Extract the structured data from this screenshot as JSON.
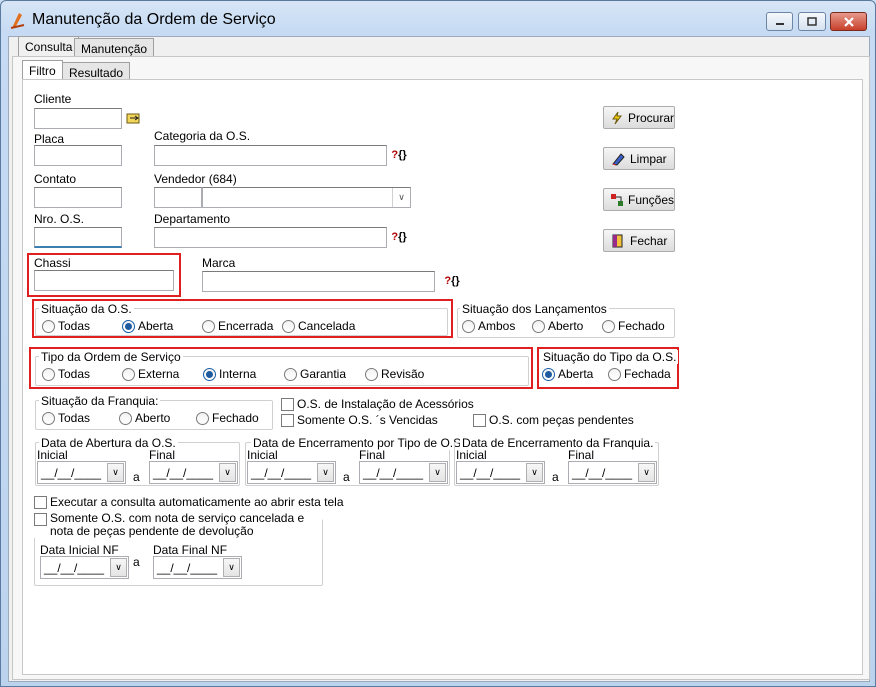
{
  "window": {
    "title": "Manutenção da Ordem de Serviço",
    "minimize_icon": "minimize-icon",
    "maximize_icon": "maximize-icon",
    "close_icon": "close-icon"
  },
  "main_tabs": [
    {
      "label": "Consulta"
    },
    {
      "label": "Manutenção"
    }
  ],
  "sub_tabs": [
    {
      "label": "Filtro"
    },
    {
      "label": "Resultado"
    }
  ],
  "fields": {
    "cliente": {
      "label": "Cliente",
      "value": ""
    },
    "placa": {
      "label": "Placa",
      "value": ""
    },
    "categoria": {
      "label": "Categoria da O.S.",
      "value": ""
    },
    "contato": {
      "label": "Contato",
      "value": ""
    },
    "vendedor": {
      "label": "Vendedor (684)",
      "value": ""
    },
    "nro_os": {
      "label": "Nro. O.S.",
      "value": ""
    },
    "departamento": {
      "label": "Departamento",
      "value": ""
    },
    "chassi": {
      "label": "Chassi",
      "value": ""
    },
    "marca": {
      "label": "Marca",
      "value": ""
    }
  },
  "buttons": {
    "procurar": "Procurar",
    "limpar": "Limpar",
    "funcoes": "Funções",
    "fechar": "Fechar"
  },
  "situacao_os": {
    "title": "Situação da O.S.",
    "options": [
      "Todas",
      "Aberta",
      "Encerrada",
      "Cancelada"
    ],
    "selected": "Aberta"
  },
  "situacao_lancamentos": {
    "title": "Situação dos Lançamentos",
    "options": [
      "Ambos",
      "Aberto",
      "Fechado"
    ],
    "selected": ""
  },
  "tipo_os": {
    "title": "Tipo da Ordem de Serviço",
    "options": [
      "Todas",
      "Externa",
      "Interna",
      "Garantia",
      "Revisão"
    ],
    "selected": "Interna"
  },
  "situacao_tipo_os": {
    "title": "Situação do Tipo da O.S.",
    "options": [
      "Aberta",
      "Fechada"
    ],
    "selected": "Aberta"
  },
  "situacao_franquia": {
    "title": "Situação da Franquia:",
    "options": [
      "Todas",
      "Aberto",
      "Fechado"
    ],
    "selected": ""
  },
  "checks": {
    "instalacao": "O.S. de Instalação de Acessórios",
    "vencidas": "Somente O.S. ´s Vencidas",
    "pecas_pendentes": "O.S. com peças pendentes",
    "executar_auto": "Executar a consulta automaticamente ao abrir esta tela",
    "nota_cancelada": "Somente O.S. com nota de serviço cancelada e nota de peças pendente de devolução"
  },
  "date_groups": [
    {
      "title": "Data de Abertura da O.S.",
      "inicial": "Inicial",
      "final": "Final",
      "sep": "a",
      "ini_value": "__/__/____",
      "fin_value": "__/__/____"
    },
    {
      "title": "Data de Encerramento por Tipo de O.S.",
      "inicial": "Inicial",
      "final": "Final",
      "sep": "a",
      "ini_value": "__/__/____",
      "fin_value": "__/__/____"
    },
    {
      "title": "Data de Encerramento da Franquia.",
      "inicial": "Inicial",
      "final": "Final",
      "sep": "a",
      "ini_value": "__/__/____",
      "fin_value": "__/__/____"
    }
  ],
  "nf_dates": {
    "inicial_label": "Data Inicial NF",
    "final_label": "Data Final NF",
    "sep": "a",
    "ini_value": "__/__/____",
    "fin_value": "__/__/____"
  },
  "colors": {
    "highlight": "#e02020",
    "radio_selected": "#1d5aa0"
  }
}
